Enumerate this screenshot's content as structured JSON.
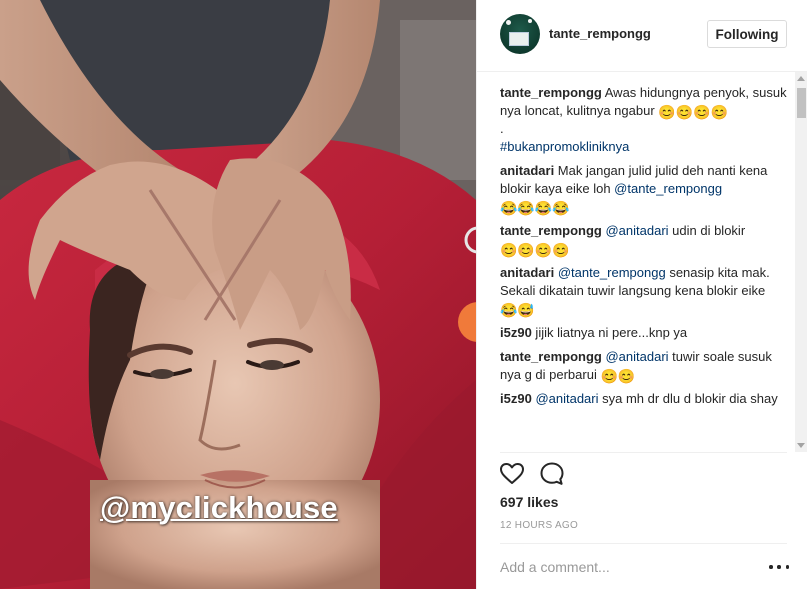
{
  "media": {
    "watermark": "@myclickhouse"
  },
  "header": {
    "username": "tante_rempongg",
    "follow_label": "Following"
  },
  "comments": [
    {
      "user": "tante_rempongg",
      "parts": [
        {
          "t": "text",
          "v": " Awas hidungnya penyok, susuk nya loncat, kulitnya ngabur "
        },
        {
          "t": "emoji",
          "v": "😊😊😊😊"
        },
        {
          "t": "br"
        },
        {
          "t": "text",
          "v": "."
        },
        {
          "t": "br"
        },
        {
          "t": "link",
          "v": "#bukanpromokliniknya"
        }
      ]
    },
    {
      "user": "anitadari",
      "parts": [
        {
          "t": "text",
          "v": " Mak jangan julid julid deh nanti kena blokir kaya eike loh "
        },
        {
          "t": "link",
          "v": "@tante_rempongg"
        },
        {
          "t": "text",
          "v": " "
        },
        {
          "t": "emoji",
          "v": "😂😂😂😂"
        }
      ]
    },
    {
      "user": "tante_rempongg",
      "parts": [
        {
          "t": "text",
          "v": " "
        },
        {
          "t": "link",
          "v": "@anitadari"
        },
        {
          "t": "text",
          "v": " udin di blokir "
        },
        {
          "t": "emoji",
          "v": "😊😊😊😊"
        }
      ]
    },
    {
      "user": "anitadari",
      "parts": [
        {
          "t": "text",
          "v": " "
        },
        {
          "t": "link",
          "v": "@tante_rempongg"
        },
        {
          "t": "text",
          "v": " senasip kita mak. Sekali dikatain tuwir langsung kena blokir eike "
        },
        {
          "t": "emoji",
          "v": "😂😅"
        }
      ]
    },
    {
      "user": "i5z90",
      "parts": [
        {
          "t": "text",
          "v": " jijik liatnya ni pere...knp ya"
        }
      ]
    },
    {
      "user": "tante_rempongg",
      "parts": [
        {
          "t": "text",
          "v": " "
        },
        {
          "t": "link",
          "v": "@anitadari"
        },
        {
          "t": "text",
          "v": " tuwir soale susuk nya g di perbarui "
        },
        {
          "t": "emoji",
          "v": "😊😊"
        }
      ]
    },
    {
      "user": "i5z90",
      "parts": [
        {
          "t": "text",
          "v": " "
        },
        {
          "t": "link",
          "v": "@anitadari"
        },
        {
          "t": "text",
          "v": " sya mh dr dlu d blokir dia shay"
        }
      ]
    }
  ],
  "actions": {
    "like_icon": "heart-outline-icon",
    "comment_icon": "speech-bubble-icon"
  },
  "likes_label": "697 likes",
  "timestamp": "12 HOURS AGO",
  "add_comment_placeholder": "Add a comment...",
  "colors": {
    "link": "#003569",
    "text": "#262626",
    "muted": "#999999",
    "border": "#dbdbdb"
  }
}
